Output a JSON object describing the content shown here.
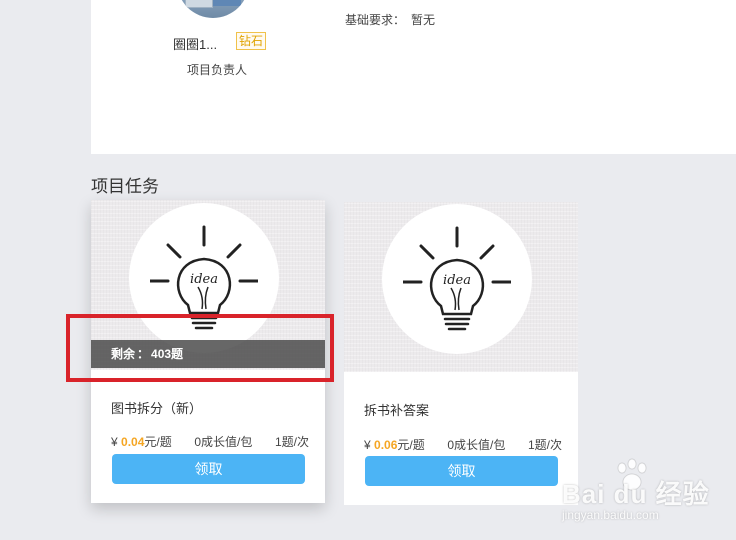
{
  "owner": {
    "name": "圈圈1...",
    "badge": "钻石",
    "role": "项目负责人"
  },
  "requirements": {
    "label": "基础要求：",
    "value": "暂无"
  },
  "section": {
    "title": "项目任务"
  },
  "tasks": [
    {
      "image_icon": "idea-lightbulb-icon",
      "remaining_label": "剩余",
      "remaining_sep": "：",
      "remaining_value": "403题",
      "title": "图书拆分（新）",
      "price_symbol": "¥",
      "price_value": "0.04",
      "price_unit": "元/题",
      "growth": "0成长值/包",
      "frequency": "1题/次",
      "button_label": "领取"
    },
    {
      "image_icon": "idea-lightbulb-icon",
      "title": "拆书补答案",
      "price_symbol": "¥",
      "price_value": "0.06",
      "price_unit": "元/题",
      "growth": "0成长值/包",
      "frequency": "1题/次",
      "button_label": "领取"
    }
  ],
  "watermark": {
    "main": "Bai du 经验",
    "sub": "jingyan.baidu.com"
  },
  "colors": {
    "accent_button": "#4cb4f5",
    "price": "#f5a623",
    "highlight_box": "#d9232a",
    "page_bg": "#eaebef"
  }
}
